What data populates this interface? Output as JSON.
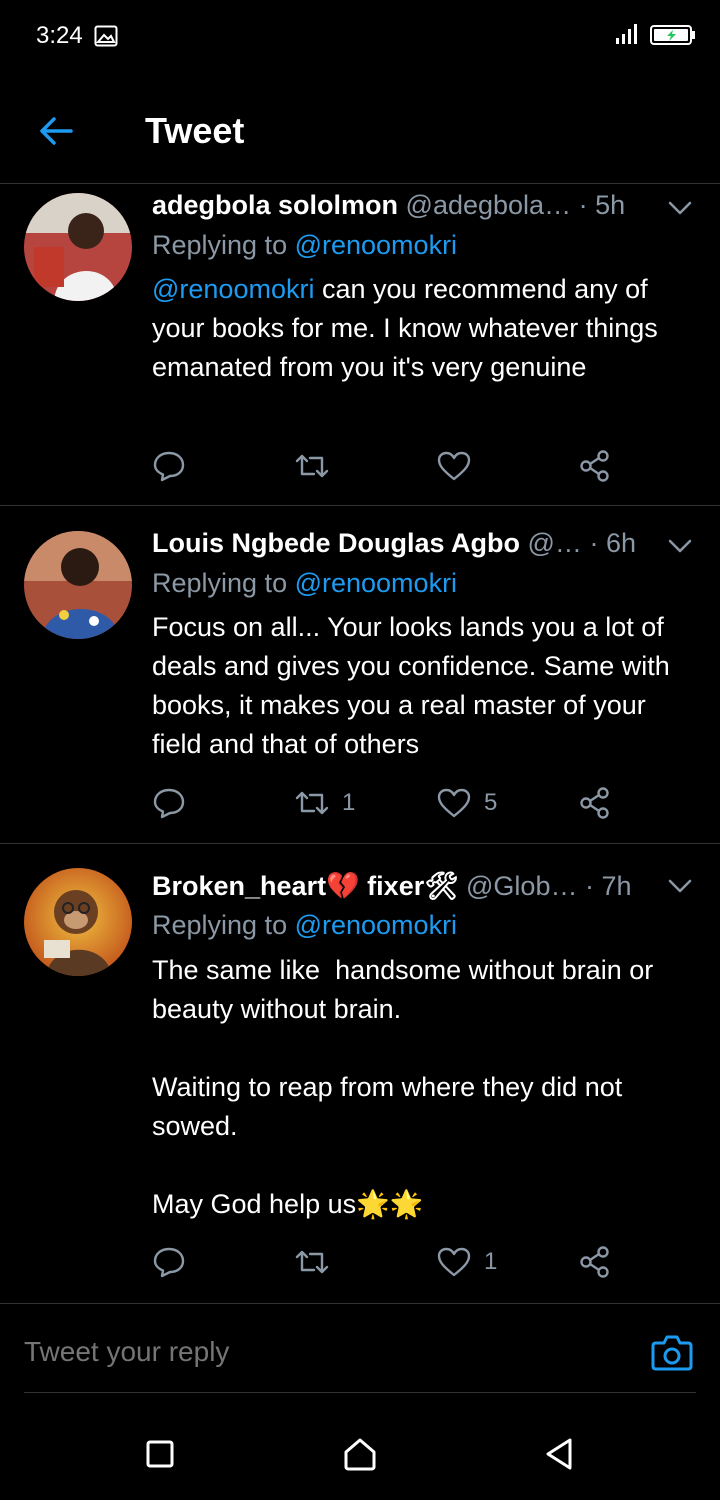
{
  "status_bar": {
    "time": "3:24"
  },
  "header": {
    "title": "Tweet"
  },
  "tweets": [
    {
      "name": "adegbola sololmon",
      "handle": "@adegbola…",
      "time": "· 5h",
      "replying_prefix": "Replying to ",
      "replying_to": "@renoomokri",
      "body_mention": "@renoomokri",
      "body_text": " can you recommend any of your books for me. I know whatever things emanated from you it's very genuine",
      "retweets": "",
      "likes": ""
    },
    {
      "name": "Louis Ngbede Douglas Agbo",
      "handle": "@…",
      "time": "· 6h",
      "replying_prefix": "Replying to ",
      "replying_to": "@renoomokri",
      "body_text": "Focus on all... Your looks lands you a lot of deals and gives you confidence. Same with books, it makes you a real master of your field and that of others",
      "retweets": "1",
      "likes": "5"
    },
    {
      "name": "Broken_heart💔 fixer🛠",
      "handle": "@Glob…",
      "time": "· 7h",
      "replying_prefix": "Replying to ",
      "replying_to": "@renoomokri",
      "body_text": "The same like  handsome without brain or beauty without brain.\n\nWaiting to reap from where they did not sowed.\n\nMay God help us🌟🌟",
      "retweets": "",
      "likes": "1"
    }
  ],
  "reply_bar": {
    "placeholder": "Tweet your reply"
  },
  "colors": {
    "accent": "#1d9bf0",
    "muted": "#8b98a5",
    "divider": "#2f3336",
    "background": "#000000"
  },
  "icons": {
    "status": [
      "gallery-icon",
      "signal-icon",
      "battery-charging-icon"
    ],
    "header": [
      "back-arrow-icon"
    ],
    "tweet": [
      "chevron-down-icon",
      "reply-icon",
      "retweet-icon",
      "like-icon",
      "share-icon"
    ],
    "reply_bar": [
      "camera-icon"
    ],
    "nav": [
      "recents-icon",
      "home-icon",
      "back-icon"
    ]
  }
}
